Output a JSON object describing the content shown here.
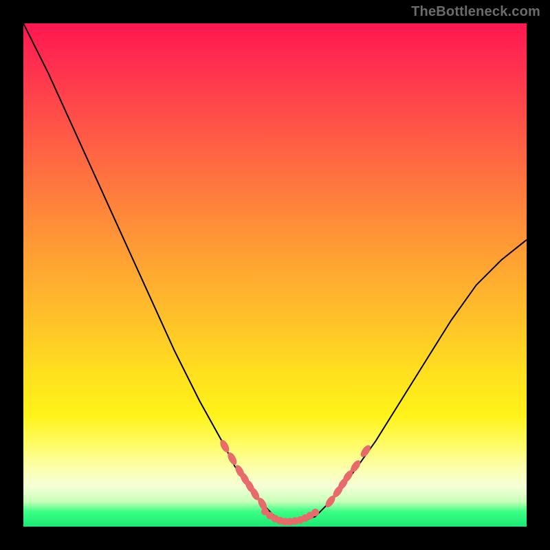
{
  "watermark": "TheBottleneck.com",
  "chart_data": {
    "type": "line",
    "title": "",
    "xlabel": "",
    "ylabel": "",
    "xlim": [
      0,
      100
    ],
    "ylim": [
      0,
      100
    ],
    "curve": {
      "x": [
        0,
        5,
        10,
        15,
        20,
        25,
        30,
        35,
        40,
        42,
        45,
        48,
        50,
        52,
        55,
        58,
        60,
        62,
        65,
        70,
        75,
        80,
        85,
        90,
        95,
        100
      ],
      "y": [
        100,
        90,
        79,
        68,
        57,
        46,
        35,
        25,
        16,
        12,
        8,
        4,
        2,
        1,
        1,
        2,
        4,
        6,
        10,
        17,
        25,
        33,
        41,
        48,
        53,
        57
      ]
    },
    "points_left": {
      "x": [
        40,
        41.5,
        43,
        44,
        45,
        46,
        47.5
      ],
      "y": [
        16,
        13.5,
        11,
        9.5,
        8,
        6.5,
        4.5
      ]
    },
    "points_bottom": {
      "x": [
        48,
        49,
        50,
        51,
        52,
        53,
        54,
        55,
        56,
        57,
        58
      ],
      "y": [
        3,
        2.2,
        1.6,
        1.2,
        1,
        1,
        1.1,
        1.3,
        1.7,
        2.2,
        2.8
      ]
    },
    "points_right": {
      "x": [
        61,
        62.5,
        63.5,
        64.5,
        66,
        68
      ],
      "y": [
        5,
        7,
        8.5,
        10,
        12,
        15
      ]
    }
  }
}
